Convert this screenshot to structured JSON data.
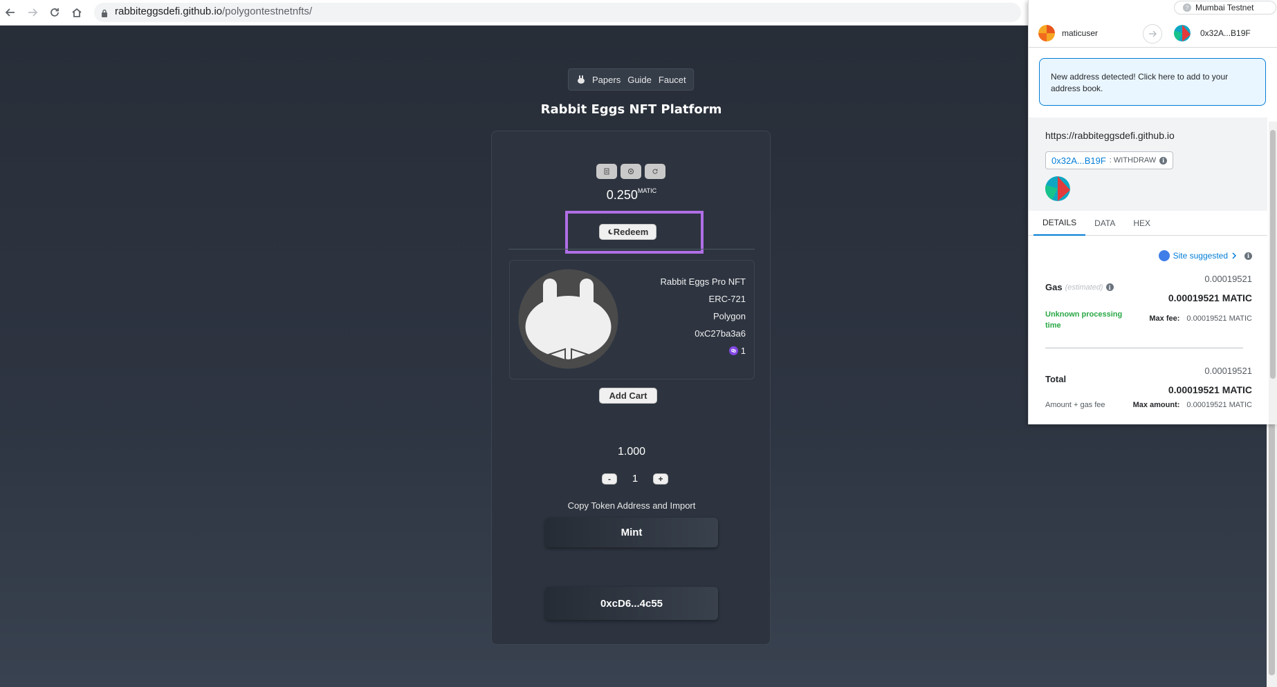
{
  "browser": {
    "url_domain": "rabbiteggsdefi.github.io",
    "url_path": "/polygontestnetnfts/"
  },
  "nav": {
    "links": [
      "Papers",
      "Guide",
      "Faucet"
    ]
  },
  "page": {
    "title": "Rabbit Eggs NFT Platform",
    "balance": "0.250",
    "balance_unit": "MATIC",
    "redeem_label": "Redeem",
    "nft": {
      "name": "Rabbit Eggs Pro NFT",
      "standard": "ERC-721",
      "chain": "Polygon",
      "contract": "0xC27ba3a6",
      "owned": "1"
    },
    "add_cart_label": "Add Cart",
    "price": "1.000",
    "quantity": "1",
    "minus_label": "-",
    "plus_label": "+",
    "copy_text": "Copy Token Address and Import",
    "mint_label": "Mint",
    "token_address": "0xcD6...4c55"
  },
  "metamask": {
    "network": "Mumbai Testnet",
    "from_account": "maticuser",
    "to_account": "0x32A...B19F",
    "alert": "New address detected! Click here to add to your address book.",
    "origin": "https://rabbiteggsdefi.github.io",
    "method_address": "0x32A...B19F",
    "method_name": ": WITHDRAW",
    "tabs": [
      "DETAILS",
      "DATA",
      "HEX"
    ],
    "site_suggested": "Site suggested",
    "gas_label": "Gas",
    "gas_estimated": "(estimated)",
    "gas_value": "0.00019521",
    "gas_value_matic": "0.00019521 MATIC",
    "unknown_time": "Unknown processing time",
    "max_fee_label": "Max fee:",
    "max_fee_value": "0.00019521 MATIC",
    "total_label": "Total",
    "total_value": "0.00019521",
    "total_value_matic": "0.00019521 MATIC",
    "amount_gas_label": "Amount + gas fee",
    "max_amount_label": "Max amount:",
    "max_amount_value": "0.00019521 MATIC"
  }
}
